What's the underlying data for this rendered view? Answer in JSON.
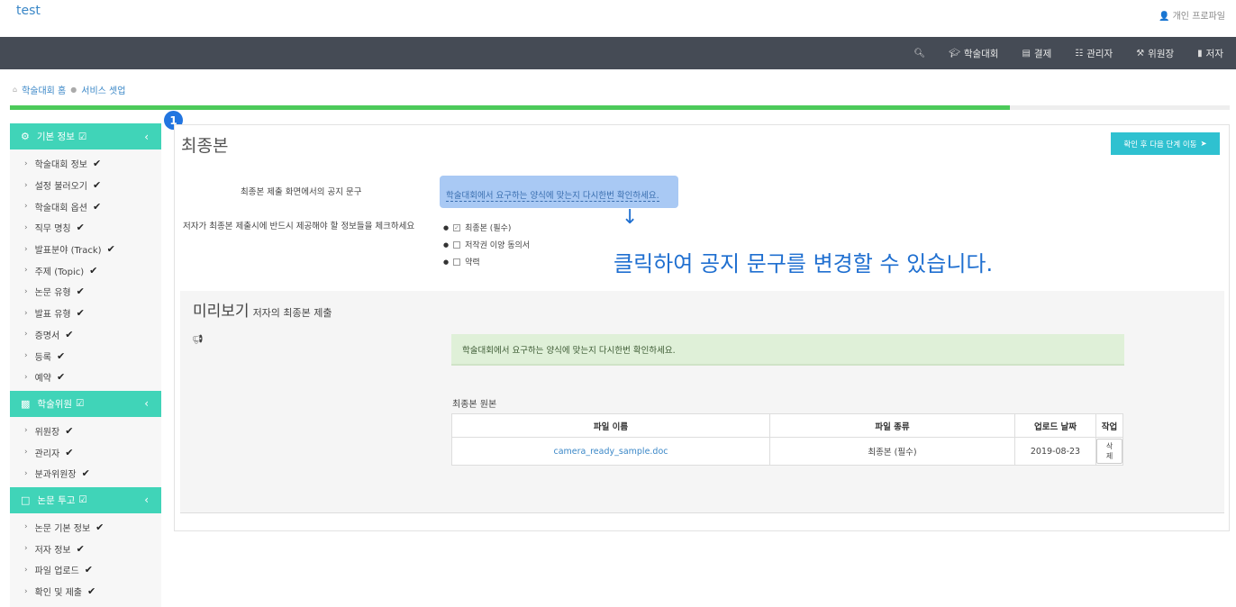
{
  "app": {
    "title": "test",
    "profile": "개인 프로파일"
  },
  "nav": [
    {
      "icon": "search-icon",
      "label": ""
    },
    {
      "icon": "graduation-cap-icon",
      "label": "학술대회"
    },
    {
      "icon": "credit-card-icon",
      "label": "결제"
    },
    {
      "icon": "server-icon",
      "label": "관리자"
    },
    {
      "icon": "gavel-icon",
      "label": "위원장"
    },
    {
      "icon": "book-icon",
      "label": "저자"
    }
  ],
  "breadcrumb": {
    "home": "학술대회 홈",
    "current": "서비스 셋업"
  },
  "progress": {
    "percent": 82
  },
  "sidebar": {
    "sections": [
      {
        "title": "기본 정보",
        "items": [
          "학술대회 정보",
          "설정 불러오기",
          "학술대회 옵션",
          "직무 명칭",
          "발표분야 (Track)",
          "주제 (Topic)",
          "논문 유형",
          "발표 유형",
          "증명서",
          "등록",
          "예약"
        ]
      },
      {
        "title": "학술위원",
        "items": [
          "위원장",
          "관리자",
          "분과위원장"
        ]
      },
      {
        "title": "논문 투고",
        "items": [
          "논문 기본 정보",
          "저자 정보",
          "파일 업로드",
          "확인 및 제출"
        ]
      }
    ]
  },
  "step_badge": "1",
  "main": {
    "title": "최종본",
    "next_button": "확인 후 다음 단계 이동",
    "notice_label": "최종본 제출 화면에서의 공지 문구",
    "notice_text": "학술대회에서 요구하는 양식에 맞는지 다시한번 확인하세요.",
    "checklist_label": "저자가 최종본 제출시에 반드시 제공해야 할 정보들을 체크하세요",
    "checklist": [
      {
        "label": "최종본 (필수)",
        "checked": true
      },
      {
        "label": "저작권 이양 동의서",
        "checked": false
      },
      {
        "label": "약력",
        "checked": false
      }
    ],
    "hint": "클릭하여 공지 문구를 변경할 수 있습니다."
  },
  "preview": {
    "title": "미리보기",
    "subtitle": "저자의 최종본 제출",
    "alert": "학술대회에서 요구하는 양식에 맞는지 다시한번 확인하세요.",
    "originals_label": "최종본 원본",
    "table": {
      "headers": [
        "파일 이름",
        "파일 종류",
        "업로드 날짜",
        "작업"
      ],
      "rows": [
        {
          "name": "camera_ready_sample.doc",
          "type": "최종본 (필수)",
          "date": "2019-08-23",
          "action": "삭제"
        }
      ]
    }
  }
}
